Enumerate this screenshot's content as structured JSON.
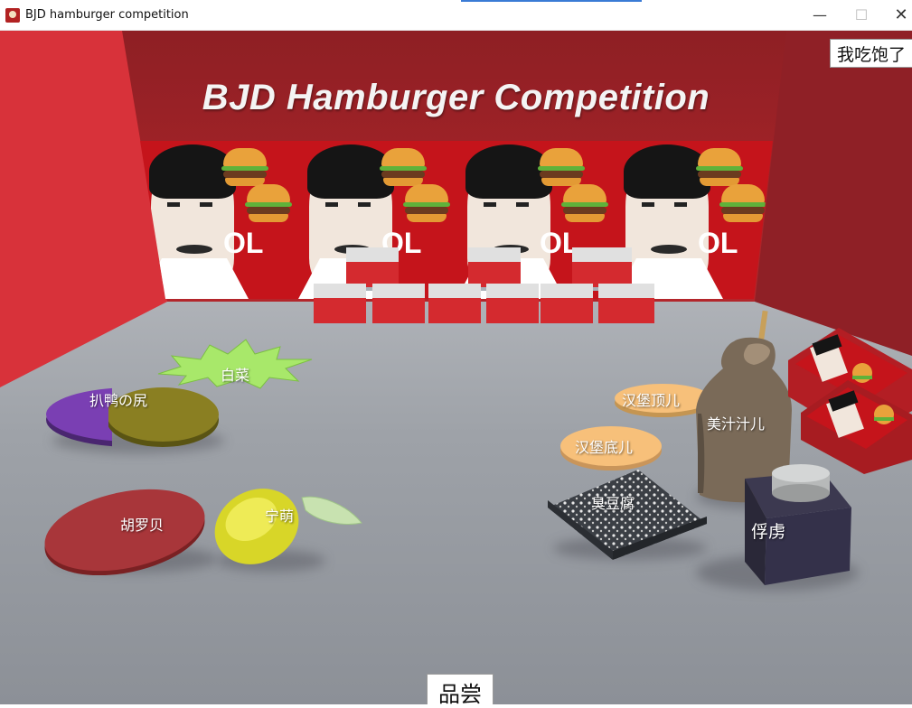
{
  "window": {
    "title": "BJD hamburger competition",
    "controls": {
      "minimize": "—",
      "maximize": "☐",
      "close": "✕"
    }
  },
  "scene": {
    "banner_title": "BJD Hamburger Competition",
    "poster_text": "OL",
    "ingredients": [
      {
        "name": "扒鸭の尻",
        "icon": "purple-olive-disc-icon"
      },
      {
        "name": "白菜",
        "icon": "green-splat-icon"
      },
      {
        "name": "胡罗贝",
        "icon": "red-disc-icon"
      },
      {
        "name": "宁萌",
        "icon": "lemon-icon"
      },
      {
        "name": "汉堡顶儿",
        "icon": "bun-top-icon"
      },
      {
        "name": "汉堡底儿",
        "icon": "bun-bottom-icon"
      },
      {
        "name": "臭豆腐",
        "icon": "tofu-block-icon"
      },
      {
        "name": "美汁汁儿",
        "icon": "sauce-bottle-icon"
      },
      {
        "name": "俘虏",
        "icon": "jar-icon"
      }
    ]
  },
  "buttons": {
    "full": "我吃饱了",
    "taste": "品尝"
  },
  "colors": {
    "wall_red": "#b3262b",
    "floor_grey": "#a8abb2",
    "poster_red": "#c5141b"
  }
}
